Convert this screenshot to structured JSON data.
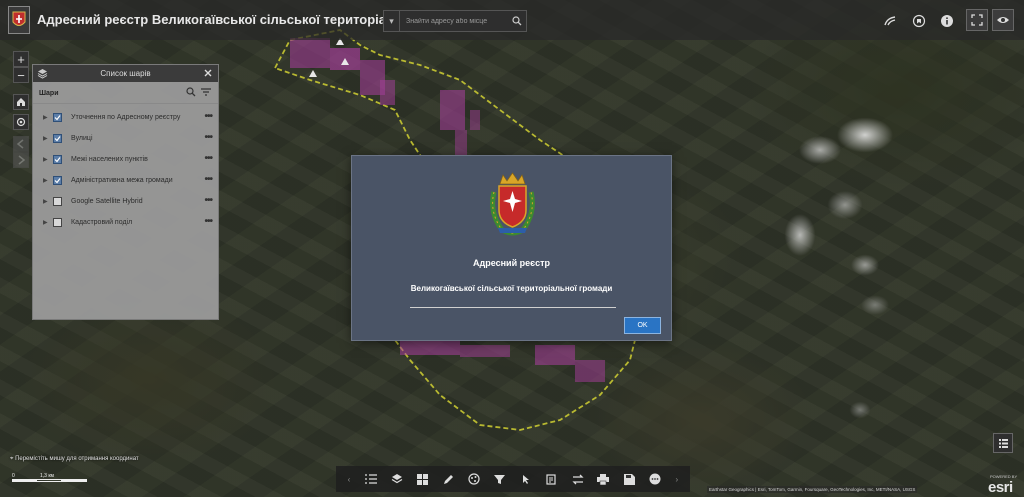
{
  "header": {
    "title": "Адресний реєстр Великогаївської сільської територіальної громади",
    "search_placeholder": "Знайти адресу або місце"
  },
  "layer_panel": {
    "title": "Список шарів",
    "subheader": "Шари",
    "layers": [
      {
        "label": "Уточнення по Адресному реєстру",
        "checked": true
      },
      {
        "label": "Вулиці",
        "checked": true
      },
      {
        "label": "Межі населених пунктів",
        "checked": true
      },
      {
        "label": "Адміністративна межа громади",
        "checked": true
      },
      {
        "label": "Google Satellite Hybrid",
        "checked": false
      },
      {
        "label": "Кадастровий поділ",
        "checked": false
      }
    ]
  },
  "dialog": {
    "title": "Адресний реєстр",
    "subtitle": "Великогаївської сільської територіальної громади",
    "ok_label": "OK"
  },
  "map_controls": {
    "zoom_in": "+",
    "zoom_out": "−"
  },
  "footer": {
    "coord_hint": "Перемістіть мишу для отримання координат",
    "scale_labels": [
      "0",
      "1,3 км"
    ],
    "attribution": "Earthstar Geographics | Esri, TomTom, Garmin, Foursquare, GeoTechnologies, Inc, METI/NASA, USGS",
    "powered_by": "POWERED BY",
    "esri_logo": "esri"
  },
  "colors": {
    "boundary": "#c8c832",
    "parcels": "#b23fa6",
    "dialog_bg": "#4a5466",
    "ok_button": "#2a74c4"
  },
  "icons": {
    "header": [
      "base-map-icon",
      "bookmark-icon",
      "info-icon",
      "fullscreen-icon",
      "visibility-icon"
    ],
    "toolbar": [
      "list-icon",
      "layers-icon",
      "basemap-gallery-icon",
      "draw-icon",
      "analysis-icon",
      "filter-icon",
      "select-icon",
      "edit-icon",
      "swipe-icon",
      "print-icon",
      "save-icon",
      "more-icon"
    ]
  }
}
